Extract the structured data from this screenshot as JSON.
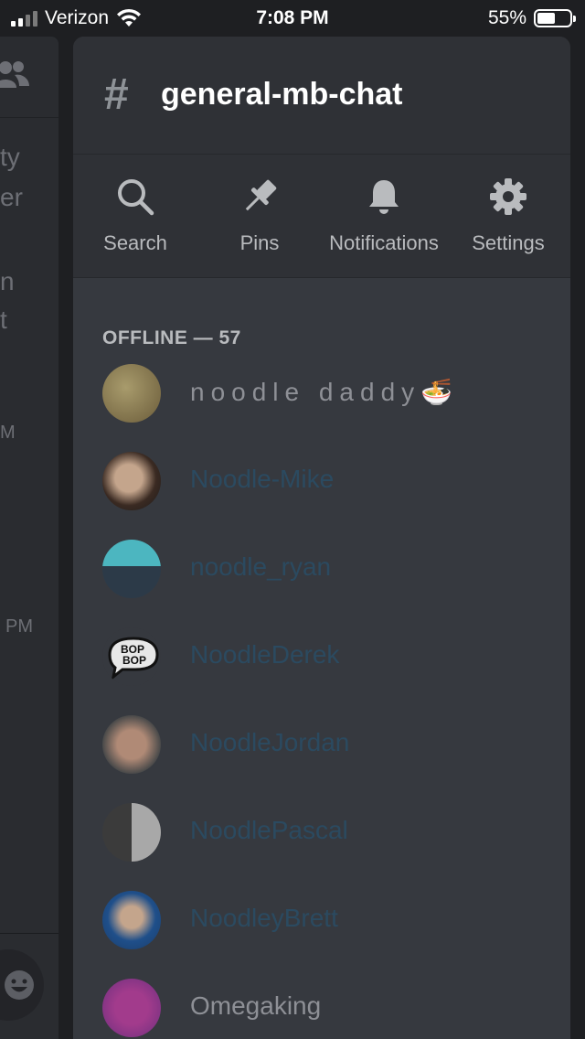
{
  "status_bar": {
    "carrier": "Verizon",
    "time": "7:08 PM",
    "battery_percent_text": "55%",
    "battery_level": 0.55
  },
  "behind_panel": {
    "fragments": [
      "ty",
      "er",
      "n",
      "t",
      "M",
      "PM"
    ]
  },
  "channel": {
    "hash": "#",
    "name": "general-mb-chat"
  },
  "toolbar": {
    "items": [
      {
        "label": "Search",
        "icon": "search-icon"
      },
      {
        "label": "Pins",
        "icon": "pin-icon"
      },
      {
        "label": "Notifications",
        "icon": "bell-icon"
      },
      {
        "label": "Settings",
        "icon": "gear-icon"
      }
    ]
  },
  "members": {
    "section_label": "OFFLINE — 57",
    "list": [
      {
        "name": "noodle daddy",
        "emoji": "🍜",
        "color": "#8e9096"
      },
      {
        "name": "Noodle-Mike",
        "color": "#2b4a60"
      },
      {
        "name": "noodle_ryan",
        "color": "#2b4a60"
      },
      {
        "name": "NoodleDerek",
        "color": "#2b4a60",
        "avatar_text": "BOP BOP"
      },
      {
        "name": "NoodleJordan",
        "color": "#2b4a60"
      },
      {
        "name": "NoodlePascal",
        "color": "#2b4a60"
      },
      {
        "name": "NoodleyBrett",
        "color": "#2b4a60"
      },
      {
        "name": "Omegaking",
        "color": "#8e9096"
      }
    ]
  },
  "colors": {
    "background": "#1e1f22",
    "panel": "#36393f",
    "header": "#2f3136",
    "muted_text": "#b9bbbe"
  }
}
